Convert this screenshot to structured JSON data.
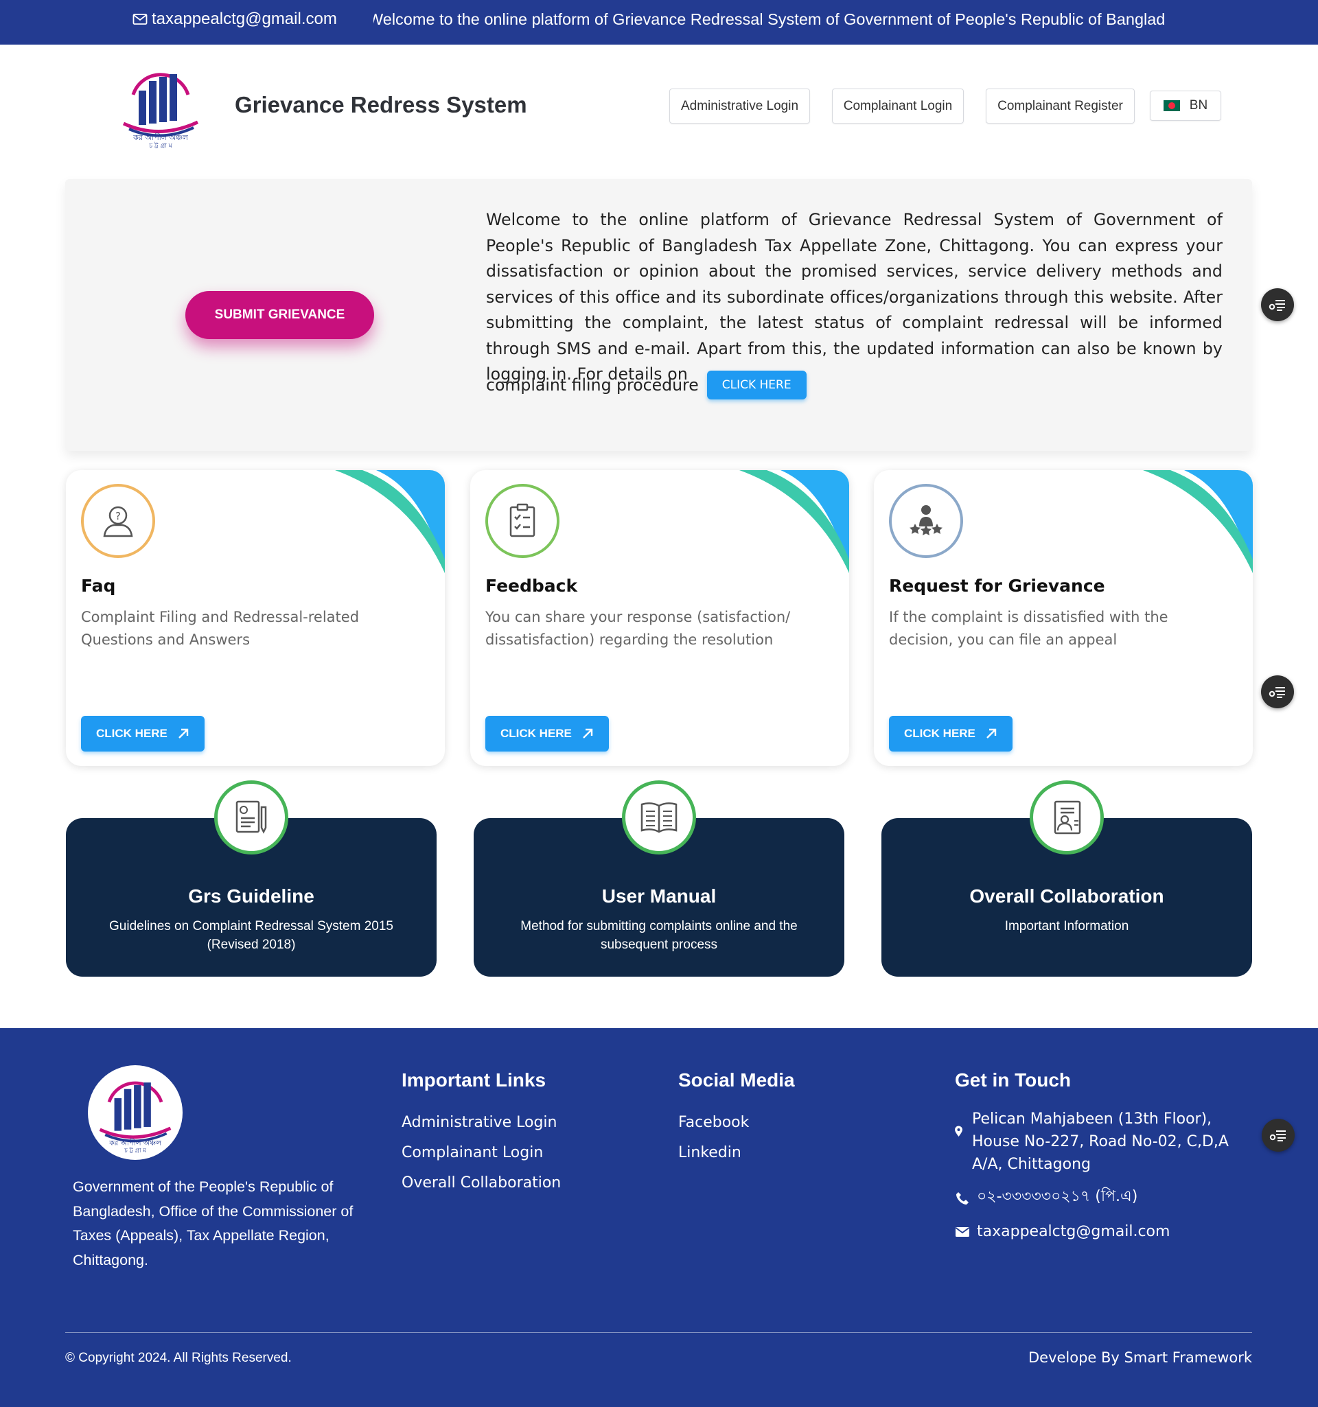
{
  "topbar": {
    "email": "taxappealctg@gmail.com",
    "marquee": "Welcome to the online platform of Grievance Redressal System of Government of People's Republic of Banglad"
  },
  "header": {
    "title": "Grievance Redress System",
    "logo_text": "কর আপীল অঞ্চল",
    "logo_subtext": "চ ট্ট গ্রা ম",
    "nav": {
      "admin_login": "Administrative Login",
      "complainant_login": "Complainant Login",
      "complainant_register": "Complainant Register",
      "language": "BN"
    }
  },
  "hero": {
    "submit_label": "SUBMIT GRIEVANCE",
    "text": "Welcome to the online platform of Grievance Redressal System of Government of People's Republic of Bangladesh Tax Appellate Zone, Chittagong. You can express your dissatisfaction or opinion about the promised services, service delivery methods and services of this office and its subordinate offices/organizations through this website. After submitting the complaint, the latest status of complaint redressal will be informed through SMS and e-mail. Apart from this, the updated information can also be known by logging in. For details on",
    "text_end": "complaint filing procedure",
    "click_label": "CLICK HERE"
  },
  "cards": [
    {
      "title": "Faq",
      "desc": "Complaint Filing and Redressal-related Questions and Answers",
      "button": "CLICK HERE"
    },
    {
      "title": "Feedback",
      "desc": "You can share your response (satisfaction/ dissatisfaction) regarding the resolution",
      "button": "CLICK HERE"
    },
    {
      "title": "Request for Grievance",
      "desc": "If the complaint is dissatisfied with the decision, you can file an appeal",
      "button": "CLICK HERE"
    }
  ],
  "info_cards": [
    {
      "title": "Grs Guideline",
      "desc": "Guidelines on Complaint Redressal System 2015 (Revised 2018)"
    },
    {
      "title": "User Manual",
      "desc": "Method for submitting complaints online and the subsequent process"
    },
    {
      "title": "Overall Collaboration",
      "desc": "Important Information"
    }
  ],
  "footer": {
    "about": "Government of the People's Republic of Bangladesh, Office of the Commissioner of Taxes (Appeals), Tax Appellate Region, Chittagong.",
    "links_heading": "Important Links",
    "links": [
      "Administrative Login",
      "Complainant Login",
      "Overall Collaboration"
    ],
    "social_heading": "Social Media",
    "social": [
      "Facebook",
      "Linkedin"
    ],
    "contact_heading": "Get in Touch",
    "address": "Pelican Mahjabeen (13th Floor), House No-227, Road No-02, C,D,A A/A, Chittagong",
    "phone": "০২-৩৩৩৩৩০২১৭ (পি.এ)",
    "email": "taxappealctg@gmail.com",
    "copyright": "© Copyright 2024. All Rights Reserved.",
    "developer": "Develope By Smart Framework"
  },
  "colors": {
    "topbar": "#233b91",
    "footer": "#203a8f",
    "primary_button": "#1f9af2",
    "submit_button": "#c8107d",
    "dark_card": "#102846",
    "icon_ring_green": "#46b457"
  }
}
